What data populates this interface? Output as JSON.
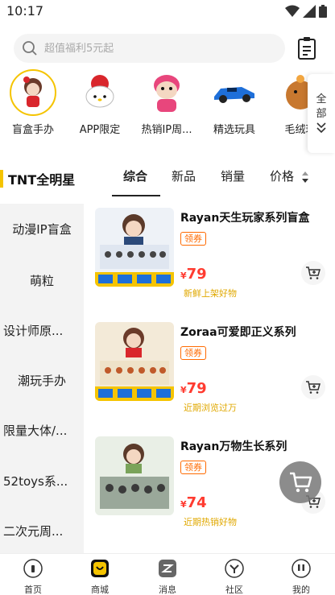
{
  "status": {
    "time": "10:17"
  },
  "search": {
    "placeholder": "超值福利5元起"
  },
  "categories": [
    {
      "label": "盲盒手办",
      "selected": true
    },
    {
      "label": "APP限定"
    },
    {
      "label": "热销IP周..."
    },
    {
      "label": "精选玩具"
    },
    {
      "label": "毛绒玩"
    }
  ],
  "all_button": {
    "label1": "全",
    "label2": "部"
  },
  "brand": {
    "name": "TNT全明星"
  },
  "tabs": [
    {
      "label": "综合",
      "active": true
    },
    {
      "label": "新品"
    },
    {
      "label": "销量"
    },
    {
      "label": "价格"
    }
  ],
  "side_menu": [
    "动漫IP盲盒",
    "萌粒",
    "设计师原...",
    "潮玩手办",
    "限量大体/...",
    "52toys系...",
    "二次元周..."
  ],
  "products": [
    {
      "title": "Rayan天生玩家系列盲盒",
      "tag": "领券",
      "yen": "¥",
      "price": "79",
      "note": "新鲜上架好物"
    },
    {
      "title": "Zoraa可爱即正义系列",
      "tag": "领券",
      "yen": "¥",
      "price": "79",
      "note": "近期浏览过万"
    },
    {
      "title": "Rayan万物生长系列",
      "tag": "领券",
      "yen": "¥",
      "price": "74",
      "note": "近期热销好物"
    }
  ],
  "bottom_nav": [
    {
      "label": "首页"
    },
    {
      "label": "商城",
      "active": true
    },
    {
      "label": "消息"
    },
    {
      "label": "社区"
    },
    {
      "label": "我的"
    }
  ],
  "colors": {
    "accent": "#f5c400",
    "price": "#ff3b30",
    "tag": "#ff6a00",
    "note": "#e0a800"
  }
}
